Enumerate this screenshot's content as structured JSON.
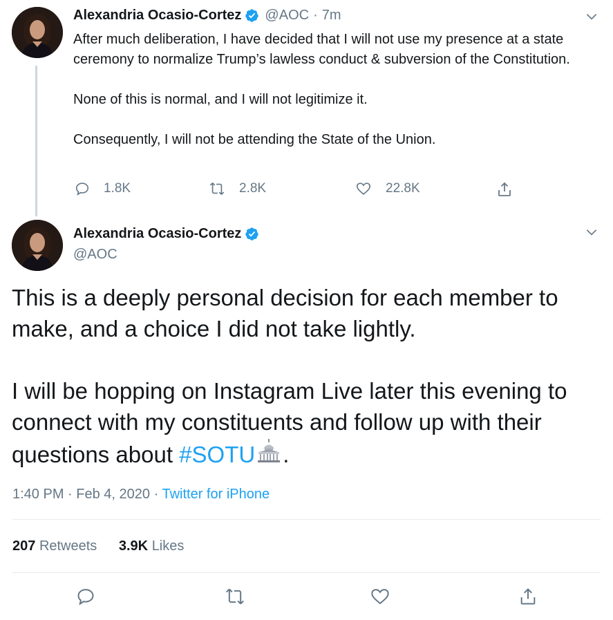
{
  "tweet1": {
    "name": "Alexandria Ocasio-Cortez",
    "handle": "@AOC",
    "separator": "·",
    "time": "7m",
    "paragraphs": [
      "After much deliberation, I have decided that I will not use my presence at a state ceremony to normalize Trump’s lawless conduct & subversion of the Constitution.",
      "None of this is normal, and I will not legitimize it.",
      "Consequently, I will not be attending the State of the Union."
    ],
    "replies": "1.8K",
    "retweets": "2.8K",
    "likes": "22.8K"
  },
  "tweet2": {
    "name": "Alexandria Ocasio-Cortez",
    "handle": "@AOC",
    "paragraph1": "This is a deeply personal decision for each member to make, and a choice I did not take lightly.",
    "paragraph2_text": "I will be hopping on Instagram Live later this evening to connect with my constituents and follow up with their questions about ",
    "hashtag": "#SOTU",
    "trailing": ".",
    "time": "1:40 PM",
    "dot1": "·",
    "date": "Feb 4, 2020",
    "dot2": "·",
    "source": "Twitter for iPhone",
    "retweet_count": "207",
    "retweet_label": "Retweets",
    "like_count": "3.9K",
    "like_label": "Likes"
  },
  "colors": {
    "accent": "#1da1f2",
    "muted": "#657786",
    "text": "#14171a",
    "divider": "#e6ecf0"
  },
  "icons": {
    "verified": "verified-badge-icon",
    "chevron": "chevron-down-icon",
    "reply": "reply-icon",
    "retweet": "retweet-icon",
    "like": "heart-icon",
    "share": "share-icon",
    "emoji": "capitol-building-icon"
  }
}
